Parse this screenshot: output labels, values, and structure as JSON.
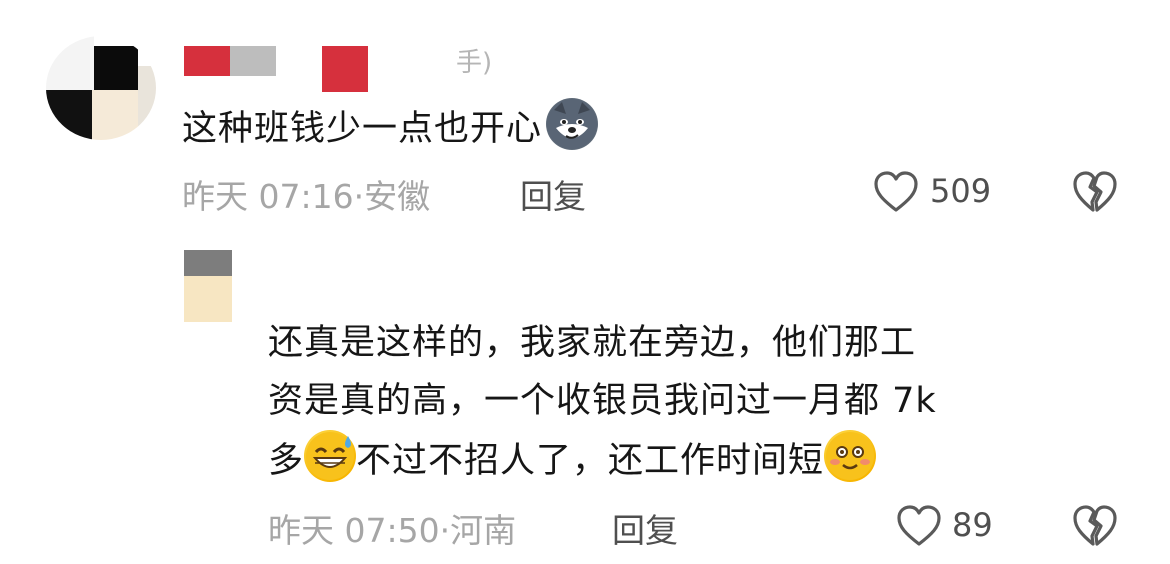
{
  "comments": [
    {
      "username_visible_fragment": "手)",
      "text": "这种班钱少一点也开心",
      "emoji": "husky-dog-smirk",
      "time": "昨天 07:16",
      "separator": "·",
      "location": "安徽",
      "reply_label": "回复",
      "likes": "509",
      "icons": {
        "like": "heart-outline-icon",
        "dislike": "broken-heart-icon"
      }
    },
    {
      "text_line1": "还真是这样的，我家就在旁边，他们那工",
      "text_line2": "资是真的高，一个收银员我问过一月都 7k",
      "text_line3_a": "多",
      "text_line3_b": "不过不招人了，还工作时间短",
      "emojis": [
        "grinning-sweat-face",
        "blushing-smile-face"
      ],
      "time": "昨天 07:50",
      "separator": "·",
      "location": "河南",
      "reply_label": "回复",
      "likes": "89",
      "icons": {
        "like": "heart-outline-icon",
        "dislike": "broken-heart-icon"
      }
    }
  ],
  "colors": {
    "text": "#161616",
    "meta": "#a6a6a6",
    "action": "#4f4f4f",
    "mosaic_red": "#d6303d",
    "mosaic_gray": "#bdbdbd"
  }
}
